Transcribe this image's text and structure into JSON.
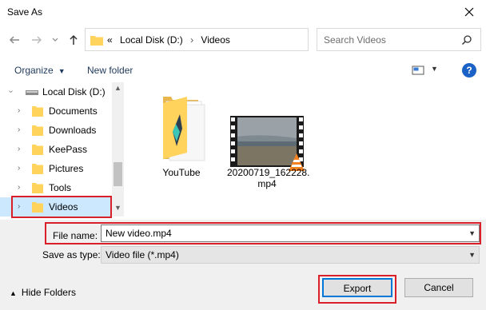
{
  "window": {
    "title": "Save As",
    "close_icon": "close-icon"
  },
  "address": {
    "prefix": "«",
    "crumbs": [
      "Local Disk (D:)",
      "Videos"
    ],
    "separator": "›"
  },
  "search": {
    "placeholder": "Search Videos"
  },
  "toolbar": {
    "organize": "Organize",
    "new_folder": "New folder",
    "help": "?"
  },
  "nav": {
    "drive": "Local Disk (D:)",
    "folders": [
      "Documents",
      "Downloads",
      "KeePass",
      "Pictures",
      "Tools",
      "Videos"
    ],
    "selected": "Videos"
  },
  "files": [
    {
      "name": "YouTube",
      "type": "folder"
    },
    {
      "name_line1": "20200719_162228.",
      "name_line2": "mp4",
      "type": "video"
    }
  ],
  "form": {
    "file_name_label": "File name:",
    "file_name_value": "New video.mp4",
    "save_type_label": "Save as type:",
    "save_type_value": "Video file (*.mp4)"
  },
  "footer": {
    "hide_folders": "Hide Folders",
    "export": "Export",
    "cancel": "Cancel"
  },
  "colors": {
    "highlight": "#d9202a",
    "accent": "#0078d7",
    "selection": "#cce8ff",
    "folder": "#ffd35c"
  }
}
